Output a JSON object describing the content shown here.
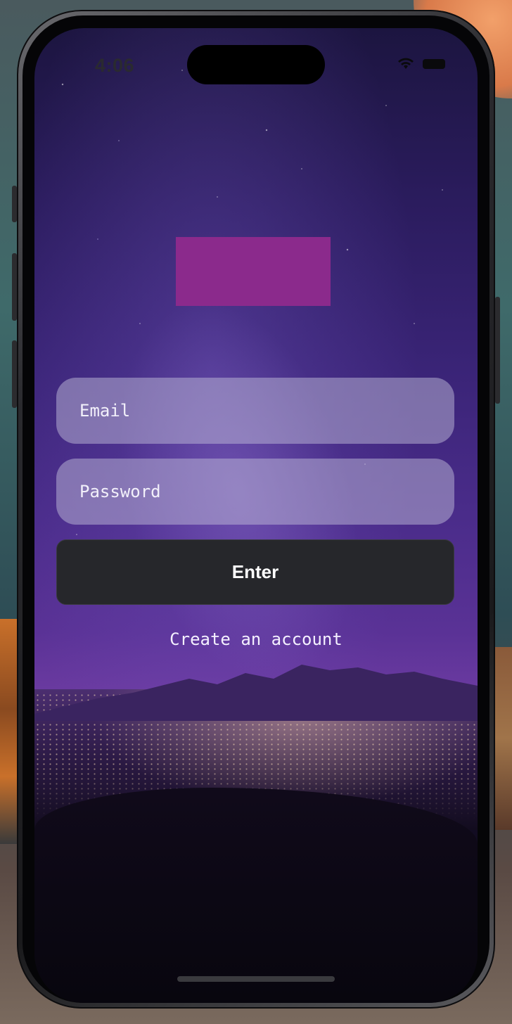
{
  "status_bar": {
    "time": "4:06",
    "wifi_icon": "wifi-icon",
    "battery_icon": "battery-icon"
  },
  "login": {
    "logo_color": "#8b2a8c",
    "email_placeholder": "Email",
    "password_placeholder": "Password",
    "enter_label": "Enter",
    "create_account_label": "Create an account"
  },
  "colors": {
    "button_bg": "#26272b",
    "field_bg": "rgba(190,185,215,0.5)",
    "accent": "#8b2a8c"
  }
}
